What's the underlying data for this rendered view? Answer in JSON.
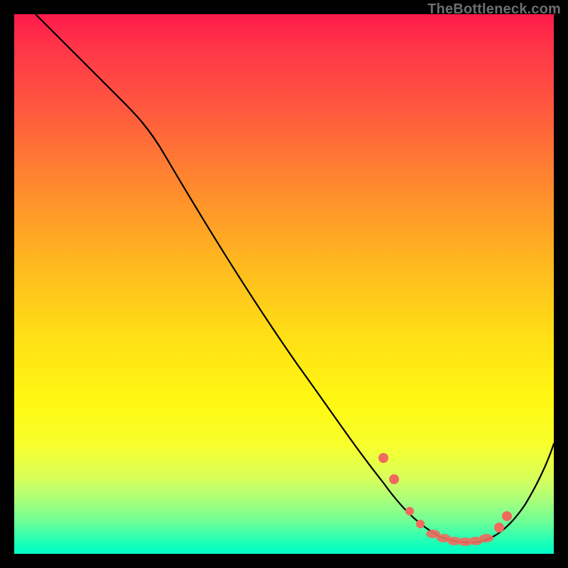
{
  "watermark": "TheBottleneck.com",
  "chart_data": {
    "type": "line",
    "title": "",
    "xlabel": "",
    "ylabel": "",
    "xlim": [
      0,
      100
    ],
    "ylim": [
      0,
      100
    ],
    "grid": false,
    "legend": false,
    "series": [
      {
        "name": "curve",
        "x": [
          4,
          10,
          20,
          28,
          40,
          50,
          60,
          66,
          71,
          74,
          78,
          83,
          87,
          91,
          100
        ],
        "values": [
          100,
          95,
          86,
          79,
          62,
          48,
          33,
          23,
          14,
          8,
          4,
          2,
          2,
          4,
          21
        ]
      }
    ],
    "markers": {
      "x": [
        68,
        70,
        73,
        75,
        77,
        79,
        80.5,
        82,
        83.5,
        85,
        86.5,
        88,
        90,
        91
      ],
      "values": [
        18,
        14,
        8,
        5.5,
        3.8,
        2.8,
        2.2,
        2.0,
        2.0,
        2.0,
        2.2,
        2.8,
        4.0,
        5.5
      ],
      "color": "#f06a5e"
    },
    "background_gradient": [
      "#ff1a4a",
      "#ff8a2e",
      "#ffe015",
      "#f7ff2e",
      "#6eff96",
      "#00ffc8"
    ]
  }
}
